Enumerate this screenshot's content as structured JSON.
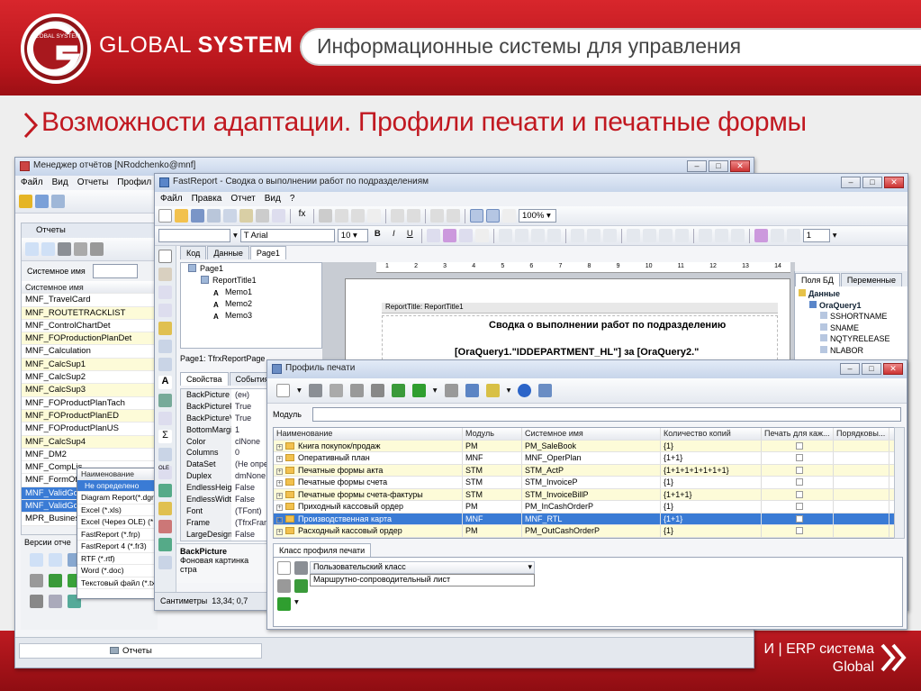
{
  "header": {
    "brand_light": "GLOBAL",
    "brand_bold": "SYSTEM",
    "tagline": "Информационные системы для управления",
    "logo_text": "GLOBAL SYSTEM"
  },
  "slide": {
    "title": "Возможности адаптации. Профили печати и печатные формы"
  },
  "footer": {
    "line1": "И | ERP система",
    "line2": "Global"
  },
  "report_manager": {
    "title": "Менеджер отчётов [NRodchenko@mnf]",
    "menu": [
      "Файл",
      "Вид",
      "Отчеты",
      "Профил"
    ],
    "panel_title": "Отчеты",
    "sysname_label": "Системное имя",
    "column_header": "Системное имя",
    "items": [
      "MNF_TravelCard",
      "MNF_ROUTETRACKLIST",
      "MNF_ControlChartDet",
      "MNF_FOProductionPlanDet",
      "MNF_Calculation",
      "MNF_CalcSup1",
      "MNF_CalcSup2",
      "MNF_CalcSup3",
      "MNF_FOProductPlanTach",
      "MNF_FOProductPlanED",
      "MNF_FOProductPlanUS",
      "MNF_CalcSup4",
      "MNF_DM2",
      "MNF_CompLis",
      "MNF_FormOf",
      "MNF_ValidGo",
      "MNF_ValidGo",
      "MPR_Busines"
    ],
    "versions_label": "Версии отче",
    "status_tab": "Отчеты",
    "dropdown": {
      "header": "Наименование",
      "selected": "Не определено",
      "items": [
        "Diagram Report(*.dgr)",
        "Excel (*.xls)",
        "Excel (Через OLE) (*.xls)",
        "FastReport (*.frp)",
        "FastReport 4 (*.fr3)",
        "RTF (*.rtf)",
        "Word (*.doc)",
        "Текстовый файл (*.txt)"
      ]
    }
  },
  "fastreport": {
    "title": "FastReport - Сводка о выполнении работ по подразделениям",
    "menu": [
      "Файл",
      "Правка",
      "Отчет",
      "Вид",
      "?"
    ],
    "zoom": "100%",
    "font": "Arial",
    "font_size": "10",
    "frame_width": "1",
    "tabs": [
      "Код",
      "Данные",
      "Page1"
    ],
    "tree": [
      {
        "label": "Page1",
        "level": 0
      },
      {
        "label": "ReportTitle1",
        "level": 1
      },
      {
        "label": "Memo1",
        "level": 2
      },
      {
        "label": "Memo2",
        "level": 2
      },
      {
        "label": "Memo3",
        "level": 2
      }
    ],
    "object_selector": "Page1: TfrxReportPage",
    "prop_tabs": [
      "Свойства",
      "События"
    ],
    "props": [
      {
        "k": "BackPicture",
        "v": "(ен)"
      },
      {
        "k": "BackPictureP",
        "v": "True"
      },
      {
        "k": "BackPictureV",
        "v": "True"
      },
      {
        "k": "BottomMargir",
        "v": "1"
      },
      {
        "k": "Color",
        "v": "clNone"
      },
      {
        "k": "Columns",
        "v": "0"
      },
      {
        "k": "DataSet",
        "v": "(Не опре"
      },
      {
        "k": "Duplex",
        "v": "dmNone"
      },
      {
        "k": "EndlessHeigh",
        "v": "False"
      },
      {
        "k": "EndlessWidth",
        "v": "False"
      },
      {
        "k": "Font",
        "v": "(TFont)"
      },
      {
        "k": "Frame",
        "v": "(TfrxFram"
      },
      {
        "k": "LargeDesignI",
        "v": "False"
      }
    ],
    "desc_title": "BackPicture",
    "desc_text": "Фоновая картинка стра",
    "status_units": "Сантиметры",
    "status_pos": "13,34; 0,7",
    "band_label": "ReportTitle: ReportTitle1",
    "report_heading": "Сводка о выполнении работ по подразделению",
    "report_expr": "[OraQuery1.\"IDDEPARTMENT_HL\"] за [OraQuery2.\"",
    "ruler": [
      "1",
      "2",
      "3",
      "4",
      "5",
      "6",
      "7",
      "8",
      "9",
      "10",
      "11",
      "12",
      "13",
      "14"
    ],
    "right_tabs": [
      "Поля БД",
      "Переменные"
    ],
    "db_tree": [
      {
        "label": "Данные",
        "level": 0
      },
      {
        "label": "OraQuery1",
        "level": 1
      },
      {
        "label": "SSHORTNAME",
        "level": 2
      },
      {
        "label": "SNAME",
        "level": 2
      },
      {
        "label": "NQTYRELEASE",
        "level": 2
      },
      {
        "label": "NLABOR",
        "level": 2
      }
    ]
  },
  "print_profile": {
    "title": "Профиль печати",
    "module_label": "Модуль",
    "columns": [
      "Наименование",
      "Модуль",
      "Системное имя",
      "Количество копий",
      "Печать для каж...",
      "Порядковы..."
    ],
    "rows": [
      {
        "name": "Книга покупок/продаж",
        "module": "PM",
        "sys": "PM_SaleBook",
        "copies": "{1}",
        "style": "y"
      },
      {
        "name": "Оперативный план",
        "module": "MNF",
        "sys": "MNF_OperPlan",
        "copies": "{1+1}",
        "style": ""
      },
      {
        "name": "Печатные формы акта",
        "module": "STM",
        "sys": "STM_ActP",
        "copies": "{1+1+1+1+1+1+1}",
        "style": "y"
      },
      {
        "name": "Печатные формы счета",
        "module": "STM",
        "sys": "STM_InvoiceP",
        "copies": "{1}",
        "style": ""
      },
      {
        "name": "Печатные формы счета-фактуры",
        "module": "STM",
        "sys": "STM_InvoiceBillP",
        "copies": "{1+1+1}",
        "style": "y"
      },
      {
        "name": "Приходный кассовый ордер",
        "module": "PM",
        "sys": "PM_InCashOrderP",
        "copies": "{1}",
        "style": ""
      },
      {
        "name": "Производственная карта",
        "module": "MNF",
        "sys": "MNF_RTL",
        "copies": "{1+1}",
        "style": "sel"
      },
      {
        "name": "Расходный кассовый ордер",
        "module": "PM",
        "sys": "PM_OutCashOrderP",
        "copies": "{1}",
        "style": "y"
      }
    ],
    "class_tab": "Класс профиля печати",
    "class_col": "Пользовательский класс",
    "class_value": "Маршрутно-сопроводительный лист"
  },
  "colors": {
    "brand_red": "#c11820",
    "selection": "#3a7bd5"
  }
}
